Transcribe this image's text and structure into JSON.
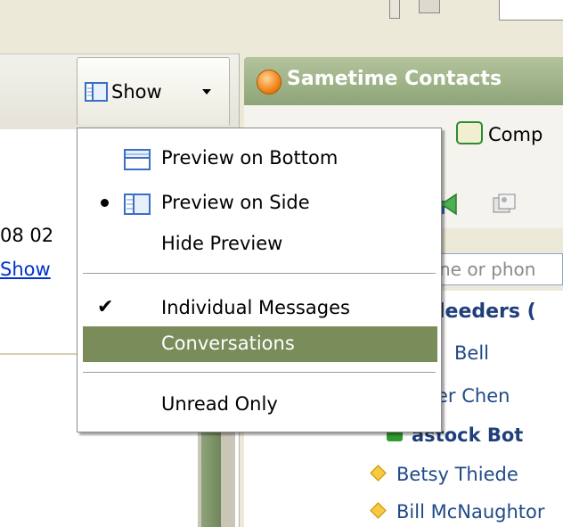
{
  "left_pane": {
    "toolbar": {
      "show_label": "Show"
    },
    "date_fragment": "08 02",
    "link_fragment": "Show"
  },
  "show_menu": {
    "items": [
      {
        "label": "Preview on Bottom",
        "icon": "preview-bottom-icon",
        "selected": false
      },
      {
        "label": "Preview on Side",
        "icon": "preview-side-icon",
        "selected": true
      },
      {
        "label": "Hide Preview",
        "selected": false
      },
      {
        "label": "Individual Messages",
        "checked": true
      },
      {
        "label": "Conversations",
        "highlighted": true
      },
      {
        "label": "Unread Only",
        "checked": false
      }
    ],
    "highlight_color": "#7b8c5b"
  },
  "sametime": {
    "title": "Sametime Contacts",
    "toolbar": {
      "comp_label": "Comp"
    },
    "search_placeholder": "ne or phon",
    "group": "leeders (",
    "contacts": [
      {
        "name": "Bell",
        "status": "none"
      },
      {
        "name": "er Chen",
        "status": "none"
      },
      {
        "name": "astock Bot",
        "status": "available-bot"
      },
      {
        "name": "Betsy Thiede",
        "status": "away-diamond"
      },
      {
        "name": "Bill McNaughtor",
        "status": "away-diamond"
      }
    ],
    "header_color": "#8ea578"
  }
}
